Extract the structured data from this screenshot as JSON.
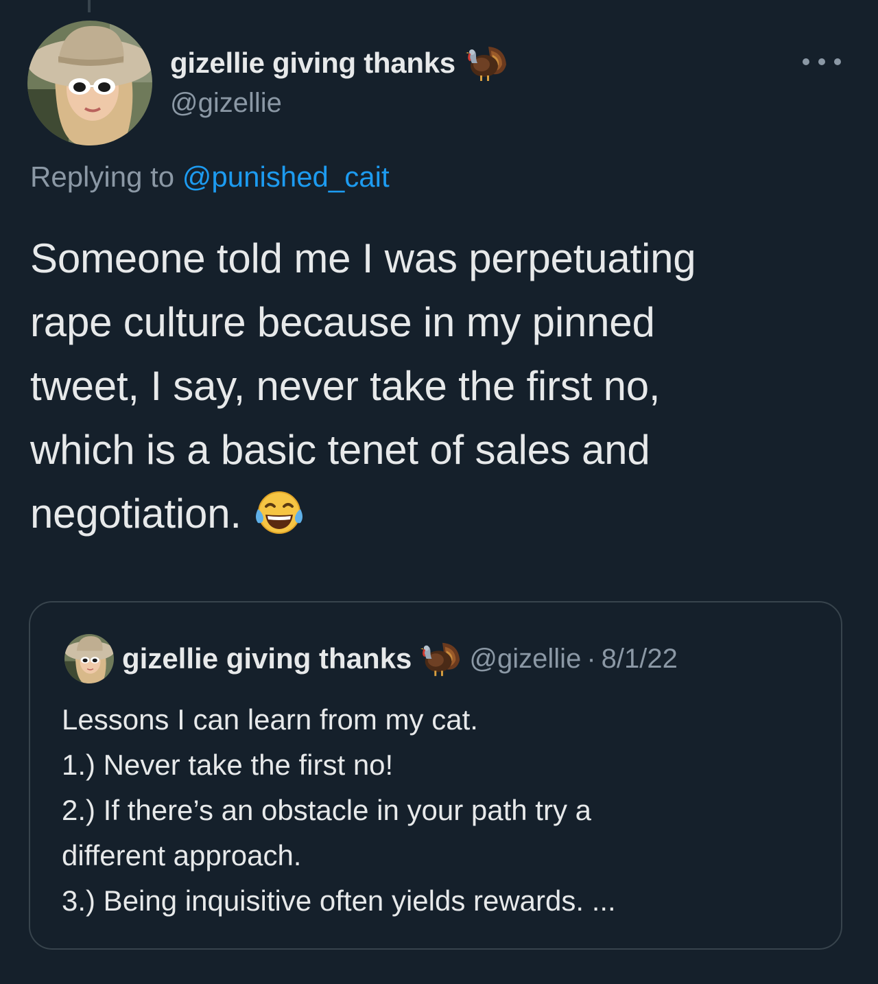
{
  "tweet": {
    "author": {
      "display_name": "gizellie giving thanks",
      "handle": "@gizellie",
      "name_badge_icon": "turkey-emoji",
      "avatar_icon": "profile-photo-woman-in-sun-hat"
    },
    "more_icon": "ellipsis-horizontal-icon",
    "replying_prefix": "Replying to",
    "replying_to": "@punished_cait",
    "text_lines": [
      "Someone told me I was perpetuating",
      "rape culture because in my pinned",
      "tweet, I say, never take the first no,",
      "which is a basic tenet of sales and",
      "negotiation."
    ],
    "text_emoji": "face-with-tears-of-joy-emoji"
  },
  "quote": {
    "author": {
      "display_name": "gizellie giving thanks",
      "handle": "@gizellie",
      "name_badge_icon": "turkey-emoji"
    },
    "separator": "·",
    "date": "8/1/22",
    "lines": [
      "Lessons I can learn from my cat.",
      "1.) Never take the first no!",
      "2.) If there’s an obstacle in your path try a",
      "different approach.",
      "3.) Being inquisitive often yields rewards. ..."
    ]
  },
  "colors": {
    "background": "#15202b",
    "primary_text": "#e7e9ea",
    "secondary_text": "#8b98a5",
    "link": "#1d9bf0",
    "border": "#38444d"
  }
}
